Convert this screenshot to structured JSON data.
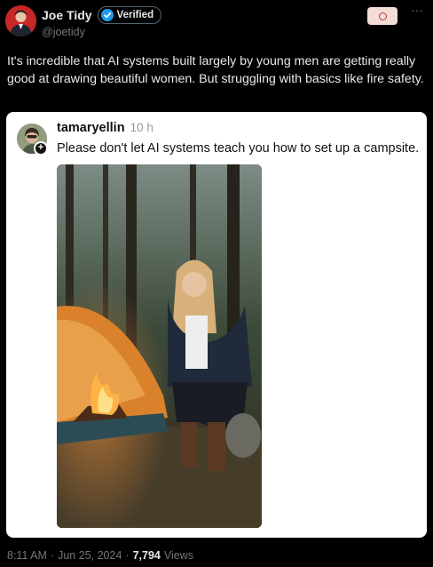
{
  "author": {
    "display_name": "Joe Tidy",
    "verified_label": "Verified",
    "handle": "@joetidy"
  },
  "actions": {
    "grok_icon": "grok-icon",
    "more_label": "···"
  },
  "tweet": {
    "text": "It's incredible that AI systems built largely by young men are getting really good at drawing beautiful women. But struggling with basics like fire safety."
  },
  "quoted": {
    "username": "tamaryellin",
    "time": "10 h",
    "add_label": "+",
    "text": "Please don't let AI systems teach you how to set up a campsite."
  },
  "footer": {
    "time": "8:11 AM",
    "date": "Jun 25, 2024",
    "sep1": "·",
    "sep2": "·",
    "views_count": "7,794",
    "views_label": "Views"
  },
  "colors": {
    "background": "#000000",
    "text": "#e7e9ea",
    "muted": "#71767b",
    "verified_blue": "#1d9bf0"
  }
}
